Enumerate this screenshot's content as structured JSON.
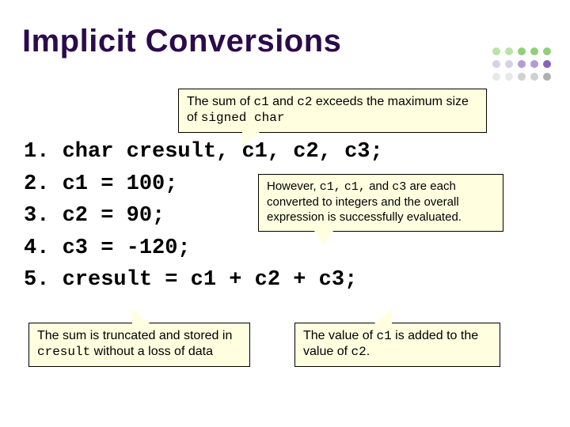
{
  "title": "Implicit Conversions",
  "callouts": {
    "top": {
      "t1": "The sum of ",
      "c1": "c1",
      "t2": " and ",
      "c2": "c2",
      "t3": " exceeds the maximum size of ",
      "c3": "signed char"
    },
    "mid": {
      "t1": "However, ",
      "c1": "c1,",
      "t2": " ",
      "c2": "c1,",
      "t3": " and ",
      "c3": "c3",
      "t4": " are each converted to integers and the overall expression is successfully evaluated."
    },
    "bl": {
      "t1": "The sum is truncated and stored in ",
      "c1": "cresult",
      "t2": " without a loss of data"
    },
    "br": {
      "t1": "The value of ",
      "c1": "c1",
      "t2": " is added to the value of ",
      "c2": "c2",
      "t3": "."
    }
  },
  "code": {
    "l1": "1. char cresult, c1, c2, c3;",
    "l2": "2. c1 = 100;",
    "l3": "3. c2 = 90;",
    "l4": "4. c3 = -120;",
    "l5": "5. cresult = c1 + c2 + c3;"
  },
  "dot_colors": [
    "#b9e3a7",
    "#b9e3a7",
    "#8fd07a",
    "#8fd07a",
    "#8fd07a",
    "#d9cfe6",
    "#d9cfe6",
    "#b49bd1",
    "#b49bd1",
    "#8a63b8",
    "#e8e8e8",
    "#e8e8e8",
    "#d0d0d0",
    "#d0d0d0",
    "#b0b0b0"
  ]
}
